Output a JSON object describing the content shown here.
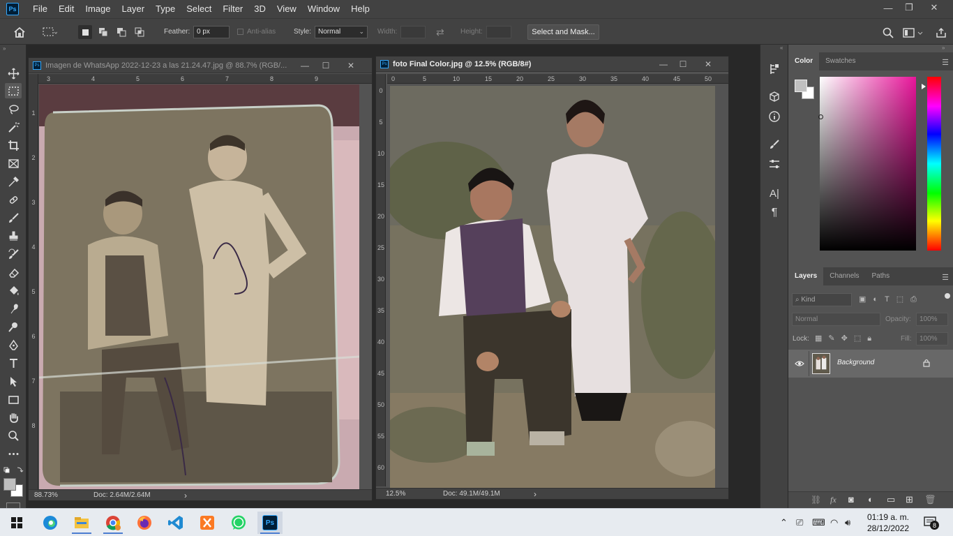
{
  "app": {
    "logo": "Ps"
  },
  "menu": [
    "File",
    "Edit",
    "Image",
    "Layer",
    "Type",
    "Select",
    "Filter",
    "3D",
    "View",
    "Window",
    "Help"
  ],
  "window_controls": {
    "minimize": "—",
    "restore": "❐",
    "close": "✕"
  },
  "options": {
    "feather_label": "Feather:",
    "feather_value": "0 px",
    "antialias_label": "Anti-alias",
    "style_label": "Style:",
    "style_value": "Normal",
    "width_label": "Width:",
    "height_label": "Height:",
    "select_mask_label": "Select and Mask..."
  },
  "doc1": {
    "title": "Imagen de WhatsApp 2022-12-23 a las 21.24.47.jpg @ 88.7% (RGB/...",
    "ruler_h": [
      "3",
      "4",
      "5",
      "6",
      "7",
      "8",
      "9"
    ],
    "ruler_v": [
      "1",
      "2",
      "3",
      "4",
      "5",
      "6",
      "7",
      "8"
    ],
    "zoom": "88.73%",
    "doc_size": "Doc: 2.64M/2.64M",
    "arrow": "›"
  },
  "doc2": {
    "title": "foto Final Color.jpg @ 12.5% (RGB/8#)",
    "ruler_h": [
      "0",
      "5",
      "10",
      "15",
      "20",
      "25",
      "30",
      "35",
      "40",
      "45",
      "50"
    ],
    "ruler_v": [
      "0",
      "5",
      "10",
      "15",
      "20",
      "25",
      "30",
      "35",
      "40",
      "45",
      "50",
      "55",
      "60"
    ],
    "zoom": "12.5%",
    "doc_size": "Doc: 49.1M/49.1M",
    "arrow": "›"
  },
  "color_panel": {
    "tabs": [
      "Color",
      "Swatches"
    ],
    "hue_color": "#e8159a"
  },
  "layers_panel": {
    "tabs": [
      "Layers",
      "Channels",
      "Paths"
    ],
    "kind_label": "Kind",
    "blend_mode": "Normal",
    "opacity_label": "Opacity:",
    "opacity_value": "100%",
    "lock_label": "Lock:",
    "fill_label": "Fill:",
    "fill_value": "100%",
    "layer_name": "Background"
  },
  "taskbar": {
    "time": "01:19 a. m.",
    "date": "28/12/2022",
    "notification_count": "8"
  }
}
